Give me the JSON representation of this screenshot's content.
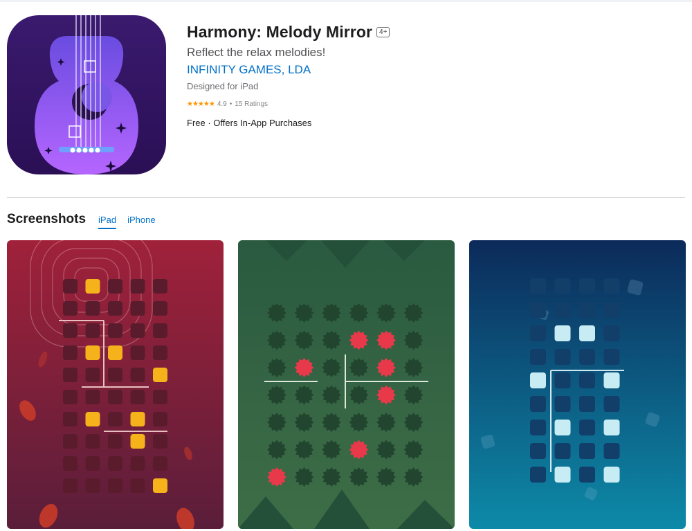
{
  "app": {
    "title": "Harmony: Melody Mirror",
    "age_rating": "4+",
    "subtitle": "Reflect the relax melodies!",
    "developer": "INFINITY GAMES, LDA",
    "designed_for": "Designed for iPad",
    "stars": "★★★★★",
    "rating_value": "4.9",
    "rating_separator": "•",
    "rating_count": "15 Ratings",
    "price": "Free · Offers In-App Purchases"
  },
  "screenshots": {
    "title": "Screenshots",
    "tabs": [
      {
        "label": "iPad",
        "active": true
      },
      {
        "label": "iPhone",
        "active": false
      }
    ]
  },
  "colors": {
    "link": "#0070c9",
    "star": "#ff9500",
    "shot1_bg": "#8e1f2e",
    "shot2_bg": "#2f5a3e",
    "shot3_bg": "#0d5f8a"
  },
  "icons": {
    "app_icon": "guitar-moon-icon"
  }
}
